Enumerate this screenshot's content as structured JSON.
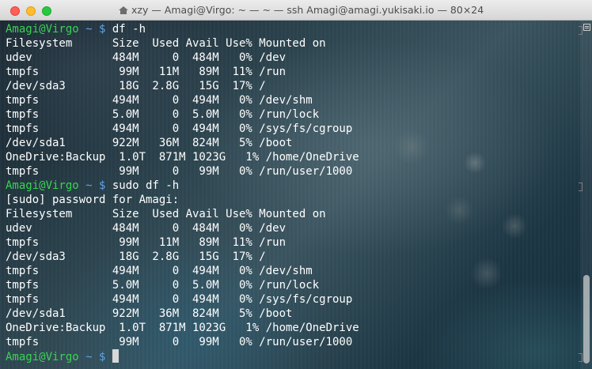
{
  "window": {
    "title": "xzy — Amagi@Virgo: ~ — ~ — ssh Amagi@amagi.yukisaki.io — 80×24",
    "icon": "home-icon",
    "controls": [
      "close",
      "minimize",
      "zoom"
    ]
  },
  "colors": {
    "prompt_user": "#39d353",
    "prompt_path": "#5ea2e6",
    "text": "#ffffff"
  },
  "terminal": {
    "prompt": {
      "user_host": "Amagi@Virgo",
      "path": "~",
      "symbol": "$"
    },
    "lines": [
      {
        "type": "prompt",
        "command": "df -h"
      },
      {
        "type": "output",
        "text": "Filesystem      Size  Used Avail Use% Mounted on"
      },
      {
        "type": "output",
        "text": "udev            484M     0  484M   0% /dev"
      },
      {
        "type": "output",
        "text": "tmpfs            99M   11M   89M  11% /run"
      },
      {
        "type": "output",
        "text": "/dev/sda3        18G  2.8G   15G  17% /"
      },
      {
        "type": "output",
        "text": "tmpfs           494M     0  494M   0% /dev/shm"
      },
      {
        "type": "output",
        "text": "tmpfs           5.0M     0  5.0M   0% /run/lock"
      },
      {
        "type": "output",
        "text": "tmpfs           494M     0  494M   0% /sys/fs/cgroup"
      },
      {
        "type": "output",
        "text": "/dev/sda1       922M   36M  824M   5% /boot"
      },
      {
        "type": "output",
        "text": "OneDrive:Backup  1.0T  871M 1023G   1% /home/OneDrive"
      },
      {
        "type": "output",
        "text": "tmpfs            99M     0   99M   0% /run/user/1000"
      },
      {
        "type": "prompt",
        "command": "sudo df -h"
      },
      {
        "type": "output",
        "text": "[sudo] password for Amagi:"
      },
      {
        "type": "output",
        "text": "Filesystem      Size  Used Avail Use% Mounted on"
      },
      {
        "type": "output",
        "text": "udev            484M     0  484M   0% /dev"
      },
      {
        "type": "output",
        "text": "tmpfs            99M   11M   89M  11% /run"
      },
      {
        "type": "output",
        "text": "/dev/sda3        18G  2.8G   15G  17% /"
      },
      {
        "type": "output",
        "text": "tmpfs           494M     0  494M   0% /dev/shm"
      },
      {
        "type": "output",
        "text": "tmpfs           5.0M     0  5.0M   0% /run/lock"
      },
      {
        "type": "output",
        "text": "tmpfs           494M     0  494M   0% /sys/fs/cgroup"
      },
      {
        "type": "output",
        "text": "/dev/sda1       922M   36M  824M   5% /boot"
      },
      {
        "type": "output",
        "text": "OneDrive:Backup  1.0T  871M 1023G   1% /home/OneDrive"
      },
      {
        "type": "output",
        "text": "tmpfs            99M     0   99M   0% /run/user/1000"
      },
      {
        "type": "prompt",
        "command": "",
        "cursor": true
      }
    ]
  },
  "scrollbar": {
    "icon": "scroll-menu-icon"
  }
}
